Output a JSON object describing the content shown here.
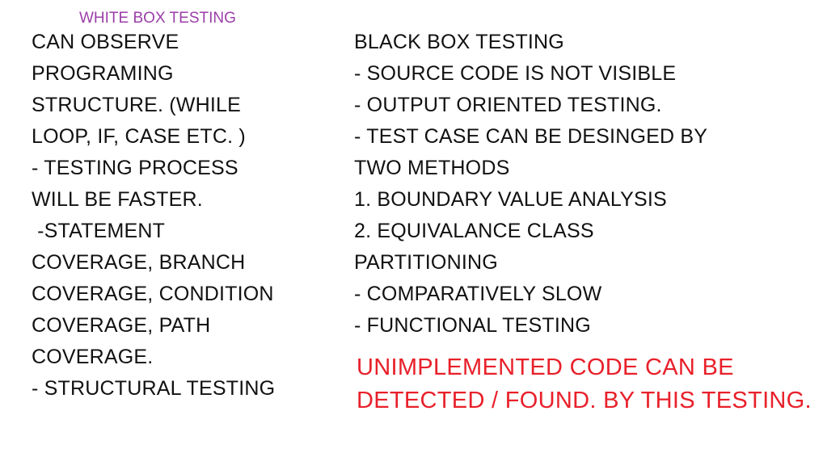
{
  "colors": {
    "heading": "#9b3fa8",
    "body_text": "#111111",
    "highlight": "#e8202a",
    "background": "#ffffff"
  },
  "white_box": {
    "heading": "WHITE BOX TESTING",
    "lines": [
      "CAN OBSERVE",
      "PROGRAMING",
      "STRUCTURE. (WHILE",
      "LOOP, IF, CASE ETC. )",
      "- TESTING PROCESS",
      "WILL BE FASTER.",
      " -STATEMENT",
      "COVERAGE, BRANCH",
      "COVERAGE, CONDITION",
      "COVERAGE, PATH",
      "COVERAGE.",
      "- STRUCTURAL TESTING"
    ]
  },
  "black_box": {
    "lines": [
      "BLACK BOX TESTING",
      "- SOURCE CODE IS NOT VISIBLE",
      "- OUTPUT ORIENTED TESTING.",
      "- TEST CASE CAN BE DESINGED BY",
      "TWO METHODS",
      "1. BOUNDARY VALUE ANALYSIS",
      "2. EQUIVALANCE CLASS",
      "PARTITIONING",
      "- COMPARATIVELY SLOW",
      "- FUNCTIONAL TESTING"
    ],
    "note_lines": [
      "UNIMPLEMENTED CODE CAN BE",
      "DETECTED / FOUND. BY THIS TESTING."
    ]
  }
}
